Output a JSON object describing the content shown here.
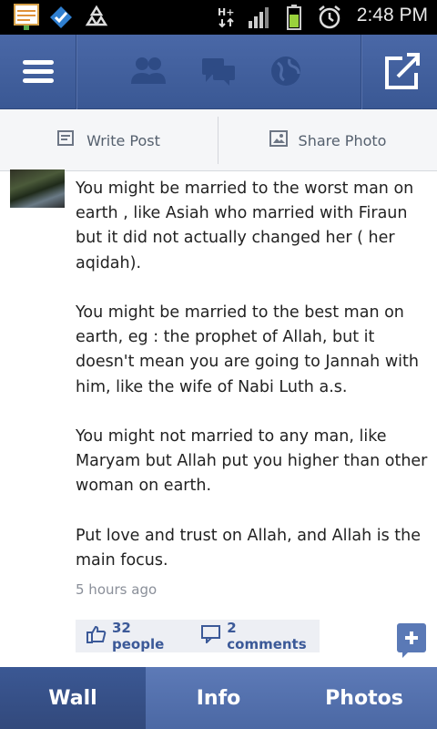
{
  "status_bar": {
    "time": "2:48 PM",
    "icons": [
      "notes-notification-icon",
      "check-shield-icon",
      "recycle-icon",
      "hplus-signal-icon",
      "signal-bars-icon",
      "battery-icon",
      "alarm-icon"
    ]
  },
  "top_nav": {
    "left_icon": "menu-icon",
    "center_icons": [
      "friends-icon",
      "messages-icon",
      "globe-icon"
    ],
    "right_icon": "share-icon"
  },
  "actions": {
    "write_post": "Write Post",
    "share_photo": "Share Photo"
  },
  "post": {
    "paragraphs": [
      "You might be married to the worst man on earth , like Asiah who married with Firaun but it did not actually changed her ( her aqidah).",
      "You might be married to the best man on earth, eg : the prophet of Allah, but it doesn't mean you are going to Jannah with him, like the wife of Nabi Luth a.s.",
      "You might not married to any man, like Maryam but Allah put you higher than other woman on earth.",
      "Put love and trust on Allah, and Allah is the main focus."
    ],
    "timestamp": "5 hours ago",
    "likes": "32 people",
    "comments": "2 comments"
  },
  "tabs": {
    "wall": "Wall",
    "info": "Info",
    "photos": "Photos",
    "active": "Wall"
  },
  "colors": {
    "brand": "#3b5998",
    "tab_active": "#35508a",
    "link": "#3b5998"
  }
}
